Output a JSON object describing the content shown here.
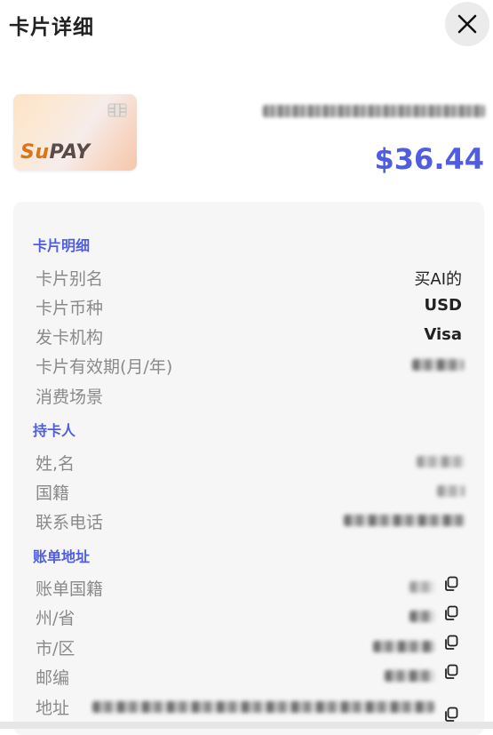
{
  "header": {
    "title": "卡片详细"
  },
  "card": {
    "brand_part1": "Su",
    "brand_part2": "PAY",
    "balance": "$36.44"
  },
  "sections": {
    "card_details": {
      "title": "卡片明细",
      "rows": [
        {
          "label": "卡片别名",
          "value": "买AI的"
        },
        {
          "label": "卡片币种",
          "value": "USD"
        },
        {
          "label": "发卡机构",
          "value": "Visa"
        },
        {
          "label": "卡片有效期(月/年)",
          "value": ""
        },
        {
          "label": "消费场景",
          "value": ""
        }
      ]
    },
    "cardholder": {
      "title": "持卡人",
      "rows": [
        {
          "label": "姓,名"
        },
        {
          "label": "国籍"
        },
        {
          "label": "联系电话"
        }
      ]
    },
    "billing": {
      "title": "账单地址",
      "rows": [
        {
          "label": "账单国籍"
        },
        {
          "label": "州/省"
        },
        {
          "label": "市/区"
        },
        {
          "label": "邮编"
        },
        {
          "label": "地址"
        }
      ]
    }
  },
  "icons": {
    "close": "close-icon",
    "copy": "copy-icon",
    "chip": "card-chip-icon"
  },
  "colors": {
    "accent": "#4f5de0",
    "brand_orange": "#d9741c"
  }
}
